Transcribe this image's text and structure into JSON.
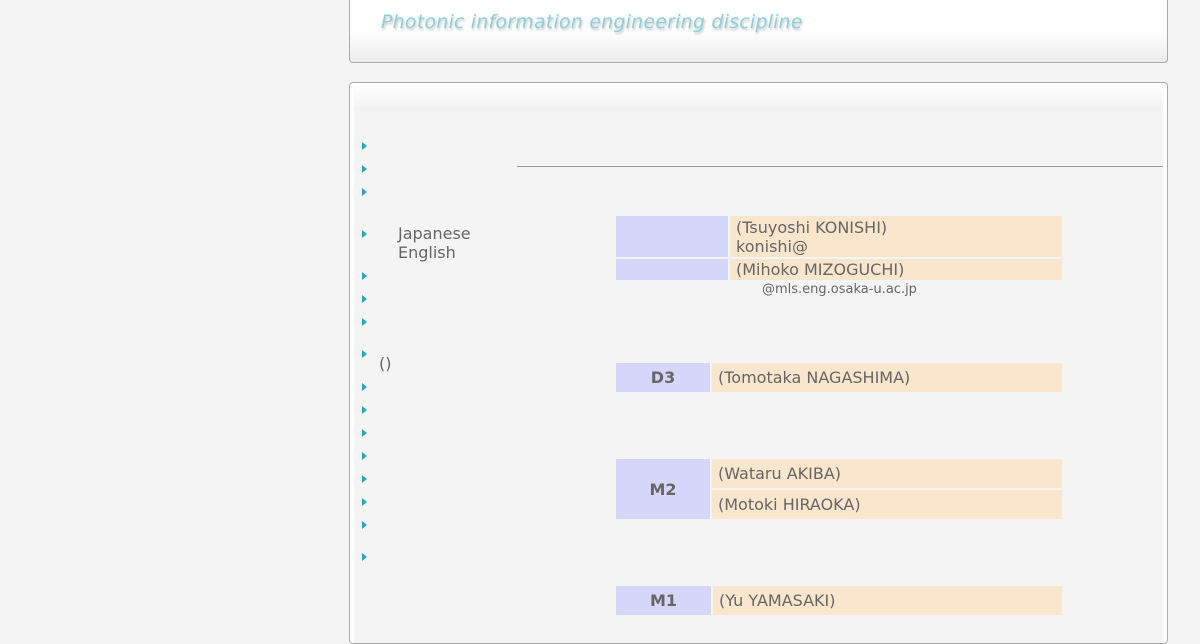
{
  "header": {
    "title": "Photonic information engineering discipline"
  },
  "nav": {
    "language": {
      "japanese": "Japanese",
      "english": "English"
    },
    "paren": "()"
  },
  "staff": {
    "row1": {
      "name": "(Tsuyoshi KONISHI)",
      "email": "konishi@"
    },
    "row2": {
      "name": "(Mihoko MIZOGUCHI)"
    },
    "email_domain": "@mls.eng.osaka-u.ac.jp"
  },
  "students": {
    "d3": {
      "label": "D3",
      "members": [
        "(Tomotaka NAGASHIMA)"
      ]
    },
    "m2": {
      "label": "M2",
      "members": [
        "(Wataru AKIBA)",
        "(Motoki HIRAOKA)"
      ]
    },
    "m1": {
      "label": "M1",
      "members": [
        "(Yu YAMASAKI)"
      ]
    }
  },
  "colors": {
    "accent": "#2aa6c2",
    "title": "#8ed0da",
    "label_bg": "#d6d6fa",
    "name_bg": "#fae5cd"
  }
}
